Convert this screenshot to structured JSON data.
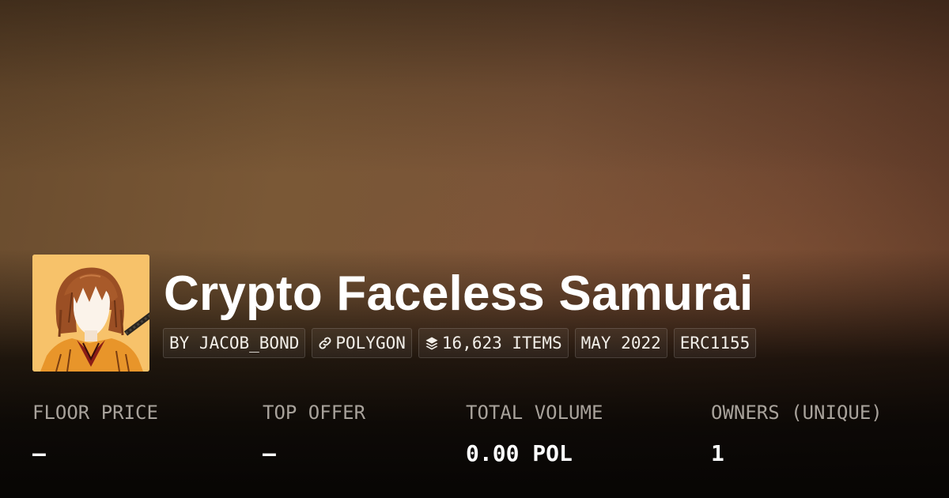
{
  "collection": {
    "title": "Crypto Faceless Samurai",
    "avatar_alt": "Crypto Faceless Samurai"
  },
  "tags": [
    {
      "label": "BY JACOB_BOND",
      "icon": ""
    },
    {
      "label": "POLYGON",
      "icon": "link-icon"
    },
    {
      "label": "16,623 ITEMS",
      "icon": "layers-icon"
    },
    {
      "label": "MAY 2022",
      "icon": ""
    },
    {
      "label": "ERC1155",
      "icon": ""
    }
  ],
  "stats": [
    {
      "label": "FLOOR PRICE",
      "value": "–"
    },
    {
      "label": "TOP OFFER",
      "value": "–"
    },
    {
      "label": "TOTAL VOLUME",
      "value": "0.00 POL"
    },
    {
      "label": "OWNERS (UNIQUE)",
      "value": "1"
    }
  ],
  "colors": {
    "banner": "#7a5836",
    "avatar_background": "#f7c26a",
    "text_primary": "#ffffff",
    "text_muted": "#a8a29b"
  }
}
